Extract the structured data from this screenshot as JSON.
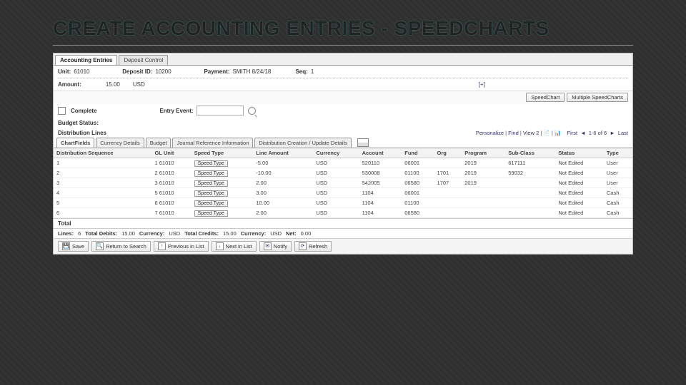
{
  "slide_title": "CREATE ACCOUNTING ENTRIES - SPEEDCHARTS",
  "tabs": [
    "Accounting Entries",
    "Deposit Control"
  ],
  "header": {
    "unit_lbl": "Unit:",
    "unit": "61010",
    "deposit_lbl": "Deposit ID:",
    "deposit": "10200",
    "payment_lbl": "Payment:",
    "payment": "SMITH 8/24/18",
    "seq_lbl": "Seq:",
    "seq": "1",
    "amount_lbl": "Amount:",
    "amount": "15.00",
    "amount_cur": "USD",
    "expand": "[+]"
  },
  "actions": {
    "speedchart": "SpeedChart",
    "multi": "Multiple SpeedCharts"
  },
  "complete_lbl": "Complete",
  "entry_event_lbl": "Entry Event:",
  "budget_status_lbl": "Budget Status:",
  "section": "Distribution Lines",
  "pers": {
    "personalize": "Personalize",
    "find": "Find",
    "view": "View 2",
    "first": "First",
    "range": "1-6 of 6",
    "last": "Last"
  },
  "inner_tabs": [
    "ChartFields",
    "Currency Details",
    "Budget",
    "Journal Reference Information",
    "Distribution Creation / Update Details"
  ],
  "cols": [
    "Distribution Sequence",
    "GL Unit",
    "Speed Type",
    "Line Amount",
    "Currency",
    "Account",
    "Fund",
    "Org",
    "Program",
    "Sub-Class",
    "Status",
    "Type"
  ],
  "speed_btn": "Speed Type",
  "rows": [
    {
      "seq": "1",
      "line": "1 61010",
      "amt": "-5.00",
      "cur": "USD",
      "acct": "520110",
      "fund": "06001",
      "org": "",
      "prog": "2019",
      "sub": "617111",
      "status": "Not Edited",
      "type": "User"
    },
    {
      "seq": "2",
      "line": "2 61010",
      "amt": "-10.00",
      "cur": "USD",
      "acct": "530008",
      "fund": "01100",
      "org": "1701",
      "prog": "2019",
      "sub": "59032",
      "status": "Not Edited",
      "type": "User"
    },
    {
      "seq": "3",
      "line": "3 61010",
      "amt": "2.00",
      "cur": "USD",
      "acct": "542005",
      "fund": "06580",
      "org": "1707",
      "prog": "2019",
      "sub": "",
      "status": "Not Edited",
      "type": "User"
    },
    {
      "seq": "4",
      "line": "5 61010",
      "amt": "3.00",
      "cur": "USD",
      "acct": "1104",
      "fund": "06001",
      "org": "",
      "prog": "",
      "sub": "",
      "status": "Not Edited",
      "type": "Cash"
    },
    {
      "seq": "5",
      "line": "6 61010",
      "amt": "10.00",
      "cur": "USD",
      "acct": "1104",
      "fund": "01100",
      "org": "",
      "prog": "",
      "sub": "",
      "status": "Not Edited",
      "type": "Cash"
    },
    {
      "seq": "6",
      "line": "7 61010",
      "amt": "2.00",
      "cur": "USD",
      "acct": "1104",
      "fund": "06580",
      "org": "",
      "prog": "",
      "sub": "",
      "status": "Not Edited",
      "type": "Cash"
    }
  ],
  "total_lbl": "Total",
  "summary": {
    "lines_lbl": "Lines:",
    "lines": "6",
    "td_lbl": "Total Debits:",
    "td": "15.00",
    "cur_lbl": "Currency:",
    "cur": "USD",
    "tc_lbl": "Total Credits:",
    "tc": "15.00",
    "cur2_lbl": "Currency:",
    "cur2": "USD",
    "net_lbl": "Net:",
    "net": "0.00"
  },
  "tools": {
    "save": "Save",
    "return": "Return to Search",
    "prev": "Previous in List",
    "next": "Next in List",
    "notify": "Notify",
    "refresh": "Refresh"
  }
}
